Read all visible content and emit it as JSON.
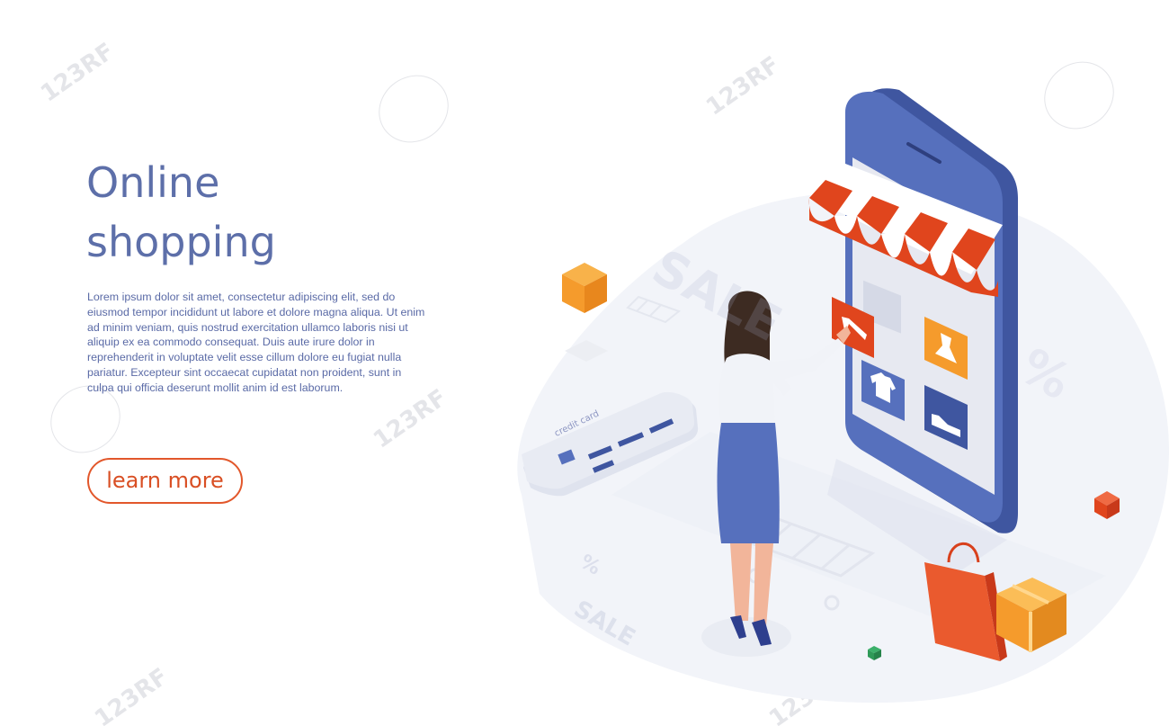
{
  "hero": {
    "title_line1": "Online",
    "title_line2": "shopping",
    "description": "Lorem ipsum dolor sit amet, consectetur adipiscing elit, sed do eiusmod tempor incididunt ut labore et dolore magna aliqua. Ut enim ad minim veniam, quis nostrud exercitation ullamco laboris nisi ut aliquip ex ea commodo consequat. Duis aute irure dolor in reprehenderit in voluptate velit esse cillum dolore eu fugiat nulla pariatur. Excepteur sint occaecat cupidatat non proident, sunt in culpa qui officia deserunt mollit anim id est laborum.",
    "cta_label": "learn more"
  },
  "illustration": {
    "credit_card_label": "credit card",
    "sale_label": "SALE",
    "percent_label": "%",
    "icons": [
      "high-heel-icon",
      "t-shirt-icon",
      "dress-icon",
      "shoe-icon",
      "shopping-cart-icon",
      "shopping-bag-icon",
      "parcel-box-icon"
    ]
  },
  "watermark": {
    "text": "123RF"
  },
  "colors": {
    "title": "#5d6fa9",
    "body_text": "#5a6aa6",
    "cta_border": "#e2572b",
    "phone_blue": "#4b62a8",
    "awning_red": "#e0451d",
    "accent_orange": "#f59b2c"
  }
}
